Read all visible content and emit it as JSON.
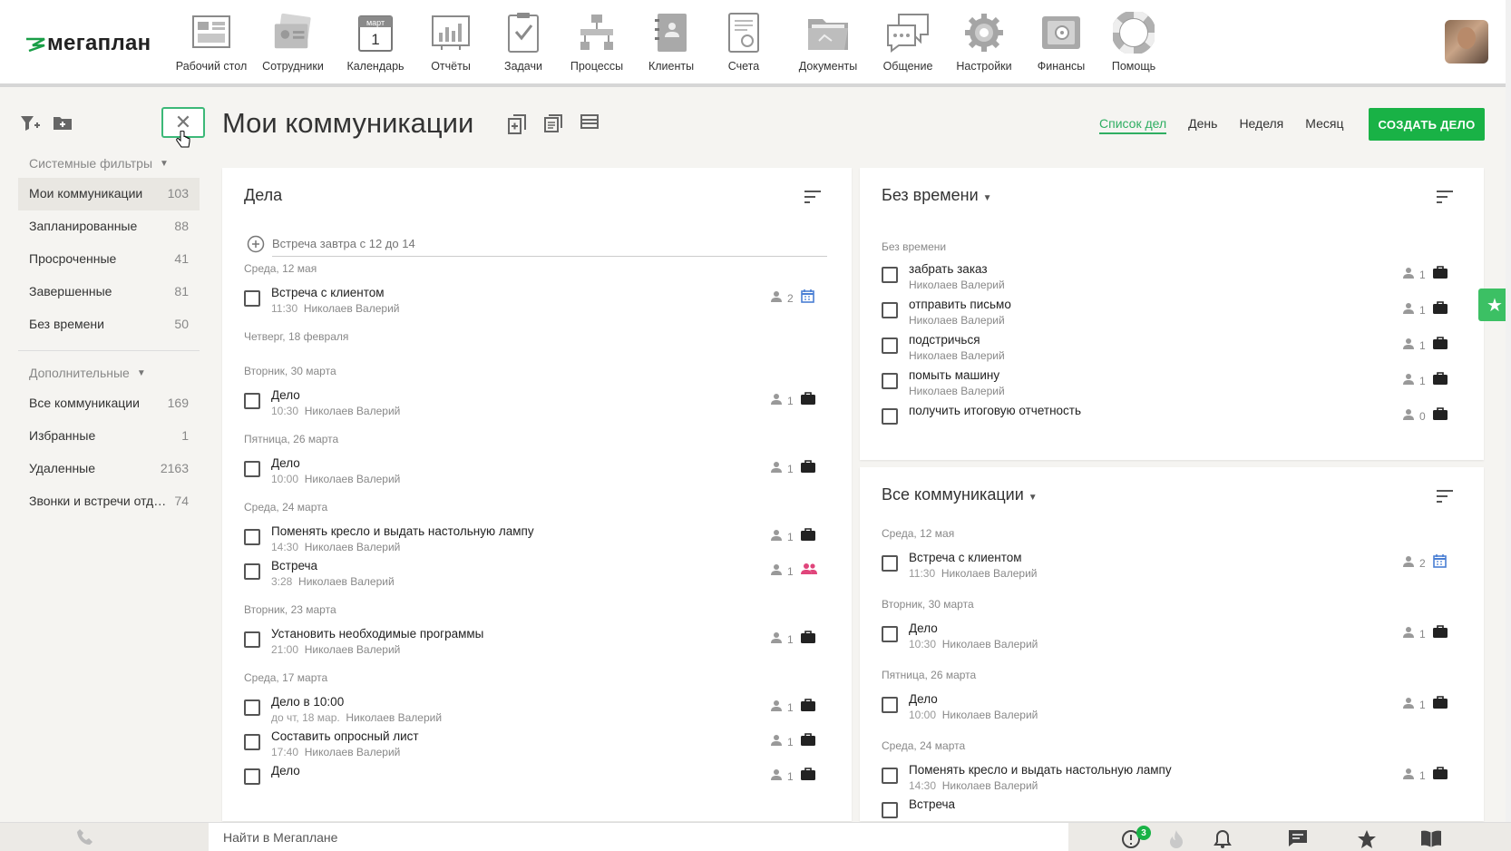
{
  "app": {
    "logo": "мегаплан"
  },
  "nav": [
    {
      "label": "Рабочий стол",
      "icon": "desktop-icon"
    },
    {
      "label": "Сотрудники",
      "icon": "employees-icon"
    },
    {
      "label": "Календарь",
      "icon": "calendar-icon",
      "cal_month": "март",
      "cal_day": "1"
    },
    {
      "label": "Отчёты",
      "icon": "reports-icon"
    },
    {
      "label": "Задачи",
      "icon": "tasks-icon"
    },
    {
      "label": "Процессы",
      "icon": "processes-icon"
    },
    {
      "label": "Клиенты",
      "icon": "clients-icon"
    },
    {
      "label": "Счета",
      "icon": "invoices-icon"
    },
    {
      "label": "Документы",
      "icon": "documents-icon"
    },
    {
      "label": "Общение",
      "icon": "chat-icon"
    },
    {
      "label": "Настройки",
      "icon": "settings-icon"
    },
    {
      "label": "Финансы",
      "icon": "finance-icon"
    },
    {
      "label": "Помощь",
      "icon": "help-icon"
    }
  ],
  "sidebar": {
    "system_filters_label": "Системные фильтры",
    "system_items": [
      {
        "label": "Мои коммуникации",
        "count": "103",
        "active": true
      },
      {
        "label": "Запланированные",
        "count": "88"
      },
      {
        "label": "Просроченные",
        "count": "41"
      },
      {
        "label": "Завершенные",
        "count": "81"
      },
      {
        "label": "Без времени",
        "count": "50"
      }
    ],
    "additional_label": "Дополнительные",
    "additional_items": [
      {
        "label": "Все коммуникации",
        "count": "169"
      },
      {
        "label": "Избранные",
        "count": "1"
      },
      {
        "label": "Удаленные",
        "count": "2163"
      },
      {
        "label": "Звонки и встречи отд…",
        "count": "74"
      }
    ]
  },
  "header": {
    "title": "Мои коммуникации",
    "views": [
      "Список дел",
      "День",
      "Неделя",
      "Месяц"
    ],
    "active_view": "Список дел",
    "create_button": "СОЗДАТЬ ДЕЛО"
  },
  "left_panel": {
    "title": "Дела",
    "add_placeholder": "Встреча завтра с 12 до 14",
    "groups": [
      {
        "date": "Среда, 12 мая",
        "tasks": [
          {
            "title": "Встреча с клиентом",
            "time": "11:30",
            "owner": "Николаев Валерий",
            "people": "2",
            "type": "calendar-icon"
          }
        ]
      },
      {
        "date": "Четверг, 18 февраля",
        "tasks": []
      },
      {
        "date": "Вторник, 30 марта",
        "tasks": [
          {
            "title": "Дело",
            "time": "10:30",
            "owner": "Николаев Валерий",
            "people": "1",
            "type": "briefcase-icon"
          }
        ]
      },
      {
        "date": "Пятница, 26 марта",
        "tasks": [
          {
            "title": "Дело",
            "time": "10:00",
            "owner": "Николаев Валерий",
            "people": "1",
            "type": "briefcase-icon"
          }
        ]
      },
      {
        "date": "Среда, 24 марта",
        "tasks": [
          {
            "title": "Поменять кресло и выдать настольную лампу",
            "time": "14:30",
            "owner": "Николаев Валерий",
            "people": "1",
            "type": "briefcase-icon"
          },
          {
            "title": "Встреча",
            "time": "3:28",
            "owner": "Николаев Валерий",
            "people": "1",
            "type": "meeting-icon"
          }
        ]
      },
      {
        "date": "Вторник, 23 марта",
        "tasks": [
          {
            "title": "Установить необходимые программы",
            "time": "21:00",
            "owner": "Николаев Валерий",
            "people": "1",
            "type": "briefcase-icon"
          }
        ]
      },
      {
        "date": "Среда, 17 марта",
        "tasks": [
          {
            "title": "Дело в 10:00",
            "time": "до чт, 18 мар.",
            "owner": "Николаев Валерий",
            "people": "1",
            "type": "briefcase-icon"
          },
          {
            "title": "Составить опросный лист",
            "time": "17:40",
            "owner": "Николаев Валерий",
            "people": "1",
            "type": "briefcase-icon"
          },
          {
            "title": "Дело",
            "time": "",
            "owner": "",
            "people": "1",
            "type": "briefcase-icon"
          }
        ]
      }
    ]
  },
  "right_top": {
    "title": "Без времени",
    "group_label": "Без времени",
    "tasks": [
      {
        "title": "забрать заказ",
        "owner": "Николаев Валерий",
        "people": "1",
        "type": "briefcase-icon"
      },
      {
        "title": "отправить письмо",
        "owner": "Николаев Валерий",
        "people": "1",
        "type": "briefcase-icon"
      },
      {
        "title": "подстричься",
        "owner": "Николаев Валерий",
        "people": "1",
        "type": "briefcase-icon"
      },
      {
        "title": "помыть машину",
        "owner": "Николаев Валерий",
        "people": "1",
        "type": "briefcase-icon"
      },
      {
        "title": "получить итоговую отчетность",
        "owner": "",
        "people": "0",
        "type": "briefcase-icon"
      }
    ]
  },
  "right_bottom": {
    "title": "Все коммуникации",
    "groups": [
      {
        "date": "Среда, 12 мая",
        "tasks": [
          {
            "title": "Встреча с клиентом",
            "time": "11:30",
            "owner": "Николаев Валерий",
            "people": "2",
            "type": "calendar-icon"
          }
        ]
      },
      {
        "date": "Вторник, 30 марта",
        "tasks": [
          {
            "title": "Дело",
            "time": "10:30",
            "owner": "Николаев Валерий",
            "people": "1",
            "type": "briefcase-icon"
          }
        ]
      },
      {
        "date": "Пятница, 26 марта",
        "tasks": [
          {
            "title": "Дело",
            "time": "10:00",
            "owner": "Николаев Валерий",
            "people": "1",
            "type": "briefcase-icon"
          }
        ]
      },
      {
        "date": "Среда, 24 марта",
        "tasks": [
          {
            "title": "Поменять кресло и выдать настольную лампу",
            "time": "14:30",
            "owner": "Николаев Валерий",
            "people": "1",
            "type": "briefcase-icon"
          },
          {
            "title": "Встреча",
            "time": "",
            "owner": "",
            "people": "",
            "type": ""
          }
        ]
      }
    ]
  },
  "bottom": {
    "search_placeholder": "Найти в Мегаплане",
    "alerts_count": "3"
  },
  "colors": {
    "accent": "#19b246",
    "link_active": "#2fae62",
    "calendar_icon": "#4a7fd4",
    "meeting_icon": "#e0457b"
  }
}
